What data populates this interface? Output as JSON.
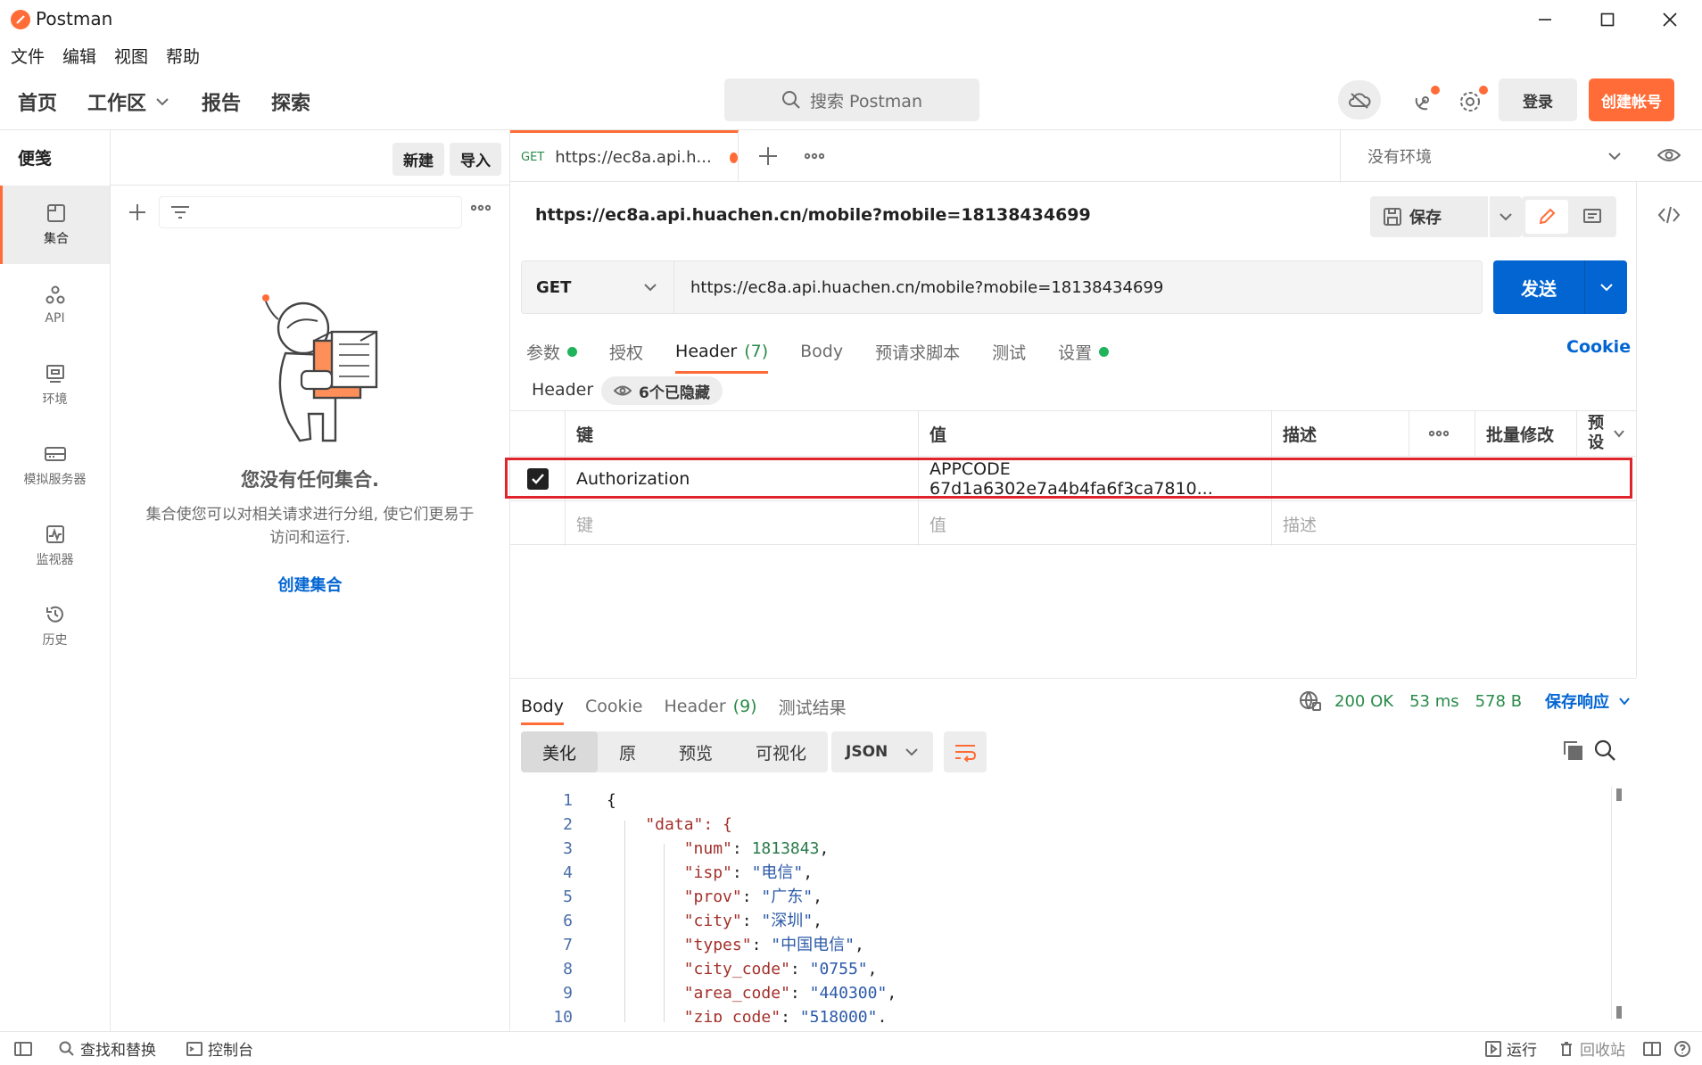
{
  "window": {
    "title": "Postman"
  },
  "menu": [
    "文件",
    "编辑",
    "视图",
    "帮助"
  ],
  "header": {
    "nav": [
      {
        "label": "首页"
      },
      {
        "label": "工作区"
      },
      {
        "label": "报告"
      },
      {
        "label": "探索"
      }
    ],
    "search_placeholder": "搜索 Postman",
    "login": "登录",
    "create_account": "创建帐号",
    "accent": "#ff6c37"
  },
  "sidebar": {
    "rail": [
      {
        "label": "集合",
        "icon": "collection-icon",
        "active": true
      },
      {
        "label": "API",
        "icon": "api-icon"
      },
      {
        "label": "环境",
        "icon": "environment-icon"
      },
      {
        "label": "模拟服务器",
        "icon": "mock-server-icon"
      },
      {
        "label": "监视器",
        "icon": "monitor-icon"
      },
      {
        "label": "历史",
        "icon": "history-icon"
      }
    ],
    "panel_title": "便笺",
    "new_label": "新建",
    "import_label": "导入",
    "empty_title": "您没有任何集合.",
    "empty_desc_1": "集合使您可以对相关请求进行分组, 使它们更易于",
    "empty_desc_2": "访问和运行.",
    "create_collection": "创建集合"
  },
  "tab": {
    "method": "GET",
    "title": "https://ec8a.api.h...",
    "env": "没有环境"
  },
  "request": {
    "name": "https://ec8a.api.huachen.cn/mobile?mobile=18138434699",
    "save": "保存",
    "method": "GET",
    "url": "https://ec8a.api.huachen.cn/mobile?mobile=18138434699",
    "send": "发送",
    "send_color": "#0265d2",
    "subtabs": [
      {
        "label": "参数",
        "dot": true
      },
      {
        "label": "授权"
      },
      {
        "label": "Header",
        "count": "(7)",
        "active": true
      },
      {
        "label": "Body"
      },
      {
        "label": "预请求脚本"
      },
      {
        "label": "测试"
      },
      {
        "label": "设置",
        "dot": true
      }
    ],
    "cookie_link": "Cookie",
    "header_label": "Header",
    "hidden_label": "6个已隐藏",
    "table": {
      "col_key": "键",
      "col_value": "值",
      "col_desc": "描述",
      "bulk_edit": "批量修改",
      "preset_1": "预",
      "preset_2": "设",
      "row": {
        "key": "Authorization",
        "value": "APPCODE 67d1a6302e7a4b4fa6f3ca7810...",
        "checked": true
      },
      "ph_key": "键",
      "ph_value": "值",
      "ph_desc": "描述"
    }
  },
  "response": {
    "tabs": [
      {
        "label": "Body",
        "active": true
      },
      {
        "label": "Cookie"
      },
      {
        "label": "Header",
        "count": "(9)"
      },
      {
        "label": "测试结果"
      }
    ],
    "status": "200 OK",
    "time": "53 ms",
    "size": "578 B",
    "save_response": "保存响应",
    "views": [
      "美化",
      "原",
      "预览",
      "可视化"
    ],
    "format": "JSON",
    "code": [
      {
        "n": "1",
        "t": "{"
      },
      {
        "n": "2",
        "t": "    \"data\": {"
      },
      {
        "n": "3",
        "k": "\"num\"",
        "v": "1813843",
        "type": "n"
      },
      {
        "n": "4",
        "k": "\"isp\"",
        "v": "\"电信\"",
        "type": "s"
      },
      {
        "n": "5",
        "k": "\"prov\"",
        "v": "\"广东\"",
        "type": "s"
      },
      {
        "n": "6",
        "k": "\"city\"",
        "v": "\"深圳\"",
        "type": "s"
      },
      {
        "n": "7",
        "k": "\"types\"",
        "v": "\"中国电信\"",
        "type": "s"
      },
      {
        "n": "8",
        "k": "\"city_code\"",
        "v": "\"0755\"",
        "type": "s"
      },
      {
        "n": "9",
        "k": "\"area_code\"",
        "v": "\"440300\"",
        "type": "s"
      },
      {
        "n": "10",
        "k": "\"zip_code\"",
        "v": "\"518000\"",
        "type": "s"
      }
    ]
  },
  "footer": {
    "find_replace": "查找和替换",
    "console": "控制台",
    "runner": "运行",
    "trash": "回收站"
  }
}
